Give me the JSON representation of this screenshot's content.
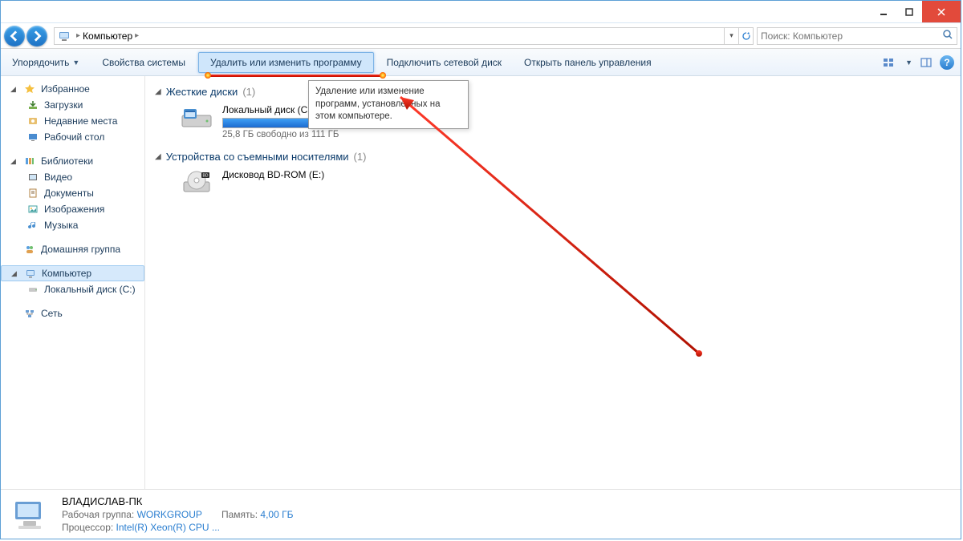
{
  "titlebar": {},
  "breadcrumb": {
    "root": "Компьютер"
  },
  "search": {
    "placeholder": "Поиск: Компьютер"
  },
  "toolbar": {
    "organize": "Упорядочить",
    "sysprops": "Свойства системы",
    "uninstall": "Удалить или изменить программу",
    "mapnet": "Подключить сетевой диск",
    "ctrlpanel": "Открыть панель управления"
  },
  "tooltip": "Удаление или изменение программ, установленных на этом компьютере.",
  "sidebar": {
    "favorites": {
      "label": "Избранное",
      "items": [
        "Загрузки",
        "Недавние места",
        "Рабочий стол"
      ]
    },
    "libraries": {
      "label": "Библиотеки",
      "items": [
        "Видео",
        "Документы",
        "Изображения",
        "Музыка"
      ]
    },
    "homegroup": "Домашняя группа",
    "computer": {
      "label": "Компьютер",
      "items": [
        "Локальный диск (C:)"
      ]
    },
    "network": "Сеть"
  },
  "content": {
    "hdd_header": "Жесткие диски",
    "hdd_count": "(1)",
    "local_disk": {
      "name": "Локальный диск (C:)",
      "free_text": "25,8 ГБ свободно из 111 ГБ",
      "used_pct": 77
    },
    "removable_header": "Устройства со съемными носителями",
    "removable_count": "(1)",
    "bdrom": "Дисковод BD-ROM (E:)"
  },
  "details": {
    "name": "ВЛАДИСЛАВ-ПК",
    "workgroup_label": "Рабочая группа:",
    "workgroup": "WORKGROUP",
    "memory_label": "Память:",
    "memory": "4,00 ГБ",
    "cpu_label": "Процессор:",
    "cpu": "Intel(R) Xeon(R) CPU    ..."
  }
}
